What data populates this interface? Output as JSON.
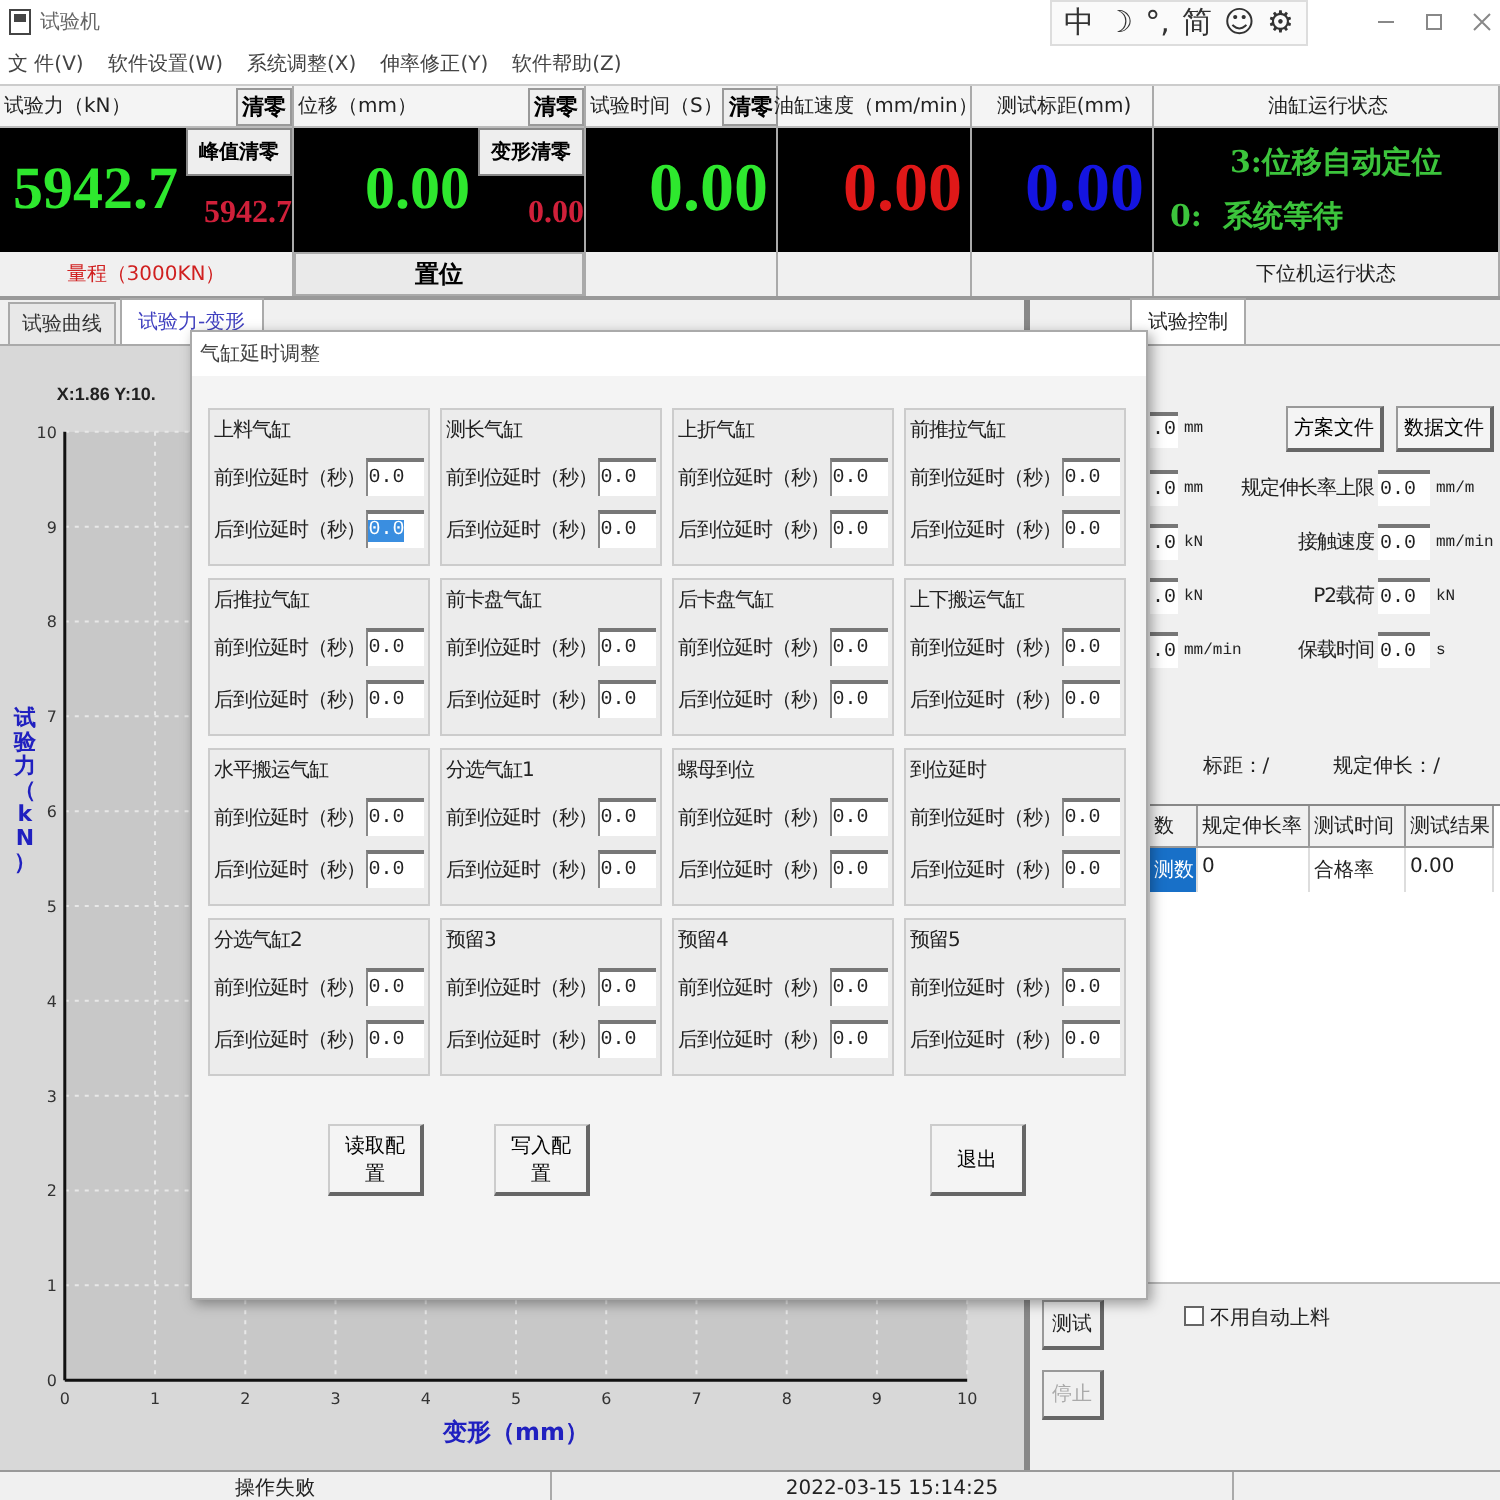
{
  "window": {
    "title": "试验机"
  },
  "ime_toolbar": [
    "中",
    "☽",
    "°,",
    "简",
    "☺",
    "⚙"
  ],
  "menu": [
    "文 件(V)",
    "软件设置(W)",
    "系统调整(X)",
    "伸率修正(Y)",
    "软件帮助(Z)"
  ],
  "readouts": [
    {
      "label": "试验力（kN）",
      "button": "清零",
      "value": "5942.7",
      "color": "#2ee82e",
      "side": {
        "button": "峰值清零",
        "value": "5942.7",
        "color": "#d0203a"
      },
      "footer": {
        "kind": "text",
        "text": "量程（3000KN）"
      }
    },
    {
      "label": "位移（mm）",
      "button": "清零",
      "value": "0.00",
      "color": "#2ee82e",
      "side": {
        "button": "变形清零",
        "value": "0.00",
        "color": "#d0203a"
      },
      "footer": {
        "kind": "button",
        "text": "置位"
      }
    },
    {
      "label": "试验时间（S）",
      "button": "清零",
      "value": "0.00",
      "color": "#2ee82e"
    },
    {
      "label": "油缸速度（mm/min）",
      "value": "0.00",
      "color": "#e01818"
    },
    {
      "label": "测试标距(mm)",
      "value": "0.00",
      "color": "#1414e0"
    },
    {
      "label": "油缸运行状态",
      "lines": [
        "3:位移自动定位",
        "0:  系统等待"
      ],
      "color": "#3cc43c",
      "footer": {
        "kind": "text",
        "text": "下位机运行状态"
      }
    }
  ],
  "chart_tabs": [
    {
      "label": "试验曲线",
      "selected": false
    },
    {
      "label": "试验力-变形",
      "selected": true
    }
  ],
  "chart": {
    "cursor": "X:1.86 Y:10.",
    "chart_data": {
      "type": "line",
      "grid": true,
      "xlabel": "变形（mm）",
      "ylabel": "试验力（kN）",
      "xlim": [
        0,
        10
      ],
      "ylim": [
        0,
        10
      ],
      "xticks": [
        0,
        1,
        2,
        3,
        4,
        5,
        6,
        7,
        8,
        9,
        10
      ],
      "yticks": [
        0,
        1,
        2,
        3,
        4,
        5,
        6,
        7,
        8,
        9,
        10
      ]
    }
  },
  "control_tabs": [
    {
      "label": "试验控制",
      "selected": true
    }
  ],
  "control": {
    "files": [
      "方案文件",
      "数据文件"
    ],
    "params": [
      {
        "value": ".0",
        "unit": "mm"
      },
      {
        "value": ".0",
        "unit": "mm",
        "label": "规定伸长率上限",
        "field": "0.0",
        "field_unit": "mm/m"
      },
      {
        "value": ".0",
        "unit": "kN",
        "label": "接触速度",
        "field": "0.0",
        "field_unit": "mm/min"
      },
      {
        "value": ".0",
        "unit": "kN",
        "label": "P2载荷",
        "field": "0.0",
        "field_unit": "kN"
      },
      {
        "value": ".0",
        "unit": "mm/min",
        "label": "保载时间",
        "field": "0.0",
        "field_unit": "s"
      }
    ],
    "summary": [
      "标距：/",
      "规定伸长：/"
    ],
    "table": {
      "columns": [
        "数",
        "规定伸长率",
        "测试时间",
        "测试结果"
      ],
      "rows": [
        {
          "selected": true,
          "cells": [
            "测数",
            "0",
            "合格率",
            "0.00"
          ]
        }
      ]
    },
    "buttons": [
      {
        "label": "测试",
        "disabled": false
      },
      {
        "label": "停止",
        "disabled": true
      }
    ],
    "checkbox": {
      "label": "不用自动上料",
      "checked": false
    }
  },
  "status_bar": [
    "操作失败",
    "2022-03-15 15:14:25"
  ],
  "dialog": {
    "title": "气缸延时调整",
    "groups": [
      {
        "title": "上料气缸",
        "fields": [
          {
            "label": "前到位延时（秒）",
            "value": "0.0",
            "selected": false
          },
          {
            "label": "后到位延时（秒）",
            "value": "0.0",
            "selected": true
          }
        ]
      },
      {
        "title": "测长气缸",
        "fields": [
          {
            "label": "前到位延时（秒）",
            "value": "0.0",
            "selected": false
          },
          {
            "label": "后到位延时（秒）",
            "value": "0.0",
            "selected": false
          }
        ]
      },
      {
        "title": "上折气缸",
        "fields": [
          {
            "label": "前到位延时（秒）",
            "value": "0.0",
            "selected": false
          },
          {
            "label": "后到位延时（秒）",
            "value": "0.0",
            "selected": false
          }
        ]
      },
      {
        "title": "前推拉气缸",
        "fields": [
          {
            "label": "前到位延时（秒）",
            "value": "0.0",
            "selected": false
          },
          {
            "label": "后到位延时（秒）",
            "value": "0.0",
            "selected": false
          }
        ]
      },
      {
        "title": "后推拉气缸",
        "fields": [
          {
            "label": "前到位延时（秒）",
            "value": "0.0",
            "selected": false
          },
          {
            "label": "后到位延时（秒）",
            "value": "0.0",
            "selected": false
          }
        ]
      },
      {
        "title": "前卡盘气缸",
        "fields": [
          {
            "label": "前到位延时（秒）",
            "value": "0.0",
            "selected": false
          },
          {
            "label": "后到位延时（秒）",
            "value": "0.0",
            "selected": false
          }
        ]
      },
      {
        "title": "后卡盘气缸",
        "fields": [
          {
            "label": "前到位延时（秒）",
            "value": "0.0",
            "selected": false
          },
          {
            "label": "后到位延时（秒）",
            "value": "0.0",
            "selected": false
          }
        ]
      },
      {
        "title": "上下搬运气缸",
        "fields": [
          {
            "label": "前到位延时（秒）",
            "value": "0.0",
            "selected": false
          },
          {
            "label": "后到位延时（秒）",
            "value": "0.0",
            "selected": false
          }
        ]
      },
      {
        "title": "水平搬运气缸",
        "fields": [
          {
            "label": "前到位延时（秒）",
            "value": "0.0",
            "selected": false
          },
          {
            "label": "后到位延时（秒）",
            "value": "0.0",
            "selected": false
          }
        ]
      },
      {
        "title": "分选气缸1",
        "fields": [
          {
            "label": "前到位延时（秒）",
            "value": "0.0",
            "selected": false
          },
          {
            "label": "后到位延时（秒）",
            "value": "0.0",
            "selected": false
          }
        ]
      },
      {
        "title": "螺母到位",
        "fields": [
          {
            "label": "前到位延时（秒）",
            "value": "0.0",
            "selected": false
          },
          {
            "label": "后到位延时（秒）",
            "value": "0.0",
            "selected": false
          }
        ]
      },
      {
        "title": "到位延时",
        "fields": [
          {
            "label": "前到位延时（秒）",
            "value": "0.0",
            "selected": false
          },
          {
            "label": "后到位延时（秒）",
            "value": "0.0",
            "selected": false
          }
        ]
      },
      {
        "title": "分选气缸2",
        "fields": [
          {
            "label": "前到位延时（秒）",
            "value": "0.0",
            "selected": false
          },
          {
            "label": "后到位延时（秒）",
            "value": "0.0",
            "selected": false
          }
        ]
      },
      {
        "title": "预留3",
        "fields": [
          {
            "label": "前到位延时（秒）",
            "value": "0.0",
            "selected": false
          },
          {
            "label": "后到位延时（秒）",
            "value": "0.0",
            "selected": false
          }
        ]
      },
      {
        "title": "预留4",
        "fields": [
          {
            "label": "前到位延时（秒）",
            "value": "0.0",
            "selected": false
          },
          {
            "label": "后到位延时（秒）",
            "value": "0.0",
            "selected": false
          }
        ]
      },
      {
        "title": "预留5",
        "fields": [
          {
            "label": "前到位延时（秒）",
            "value": "0.0",
            "selected": false
          },
          {
            "label": "后到位延时（秒）",
            "value": "0.0",
            "selected": false
          }
        ]
      }
    ],
    "buttons": [
      "读取配置",
      "写入配置",
      "退出"
    ]
  }
}
